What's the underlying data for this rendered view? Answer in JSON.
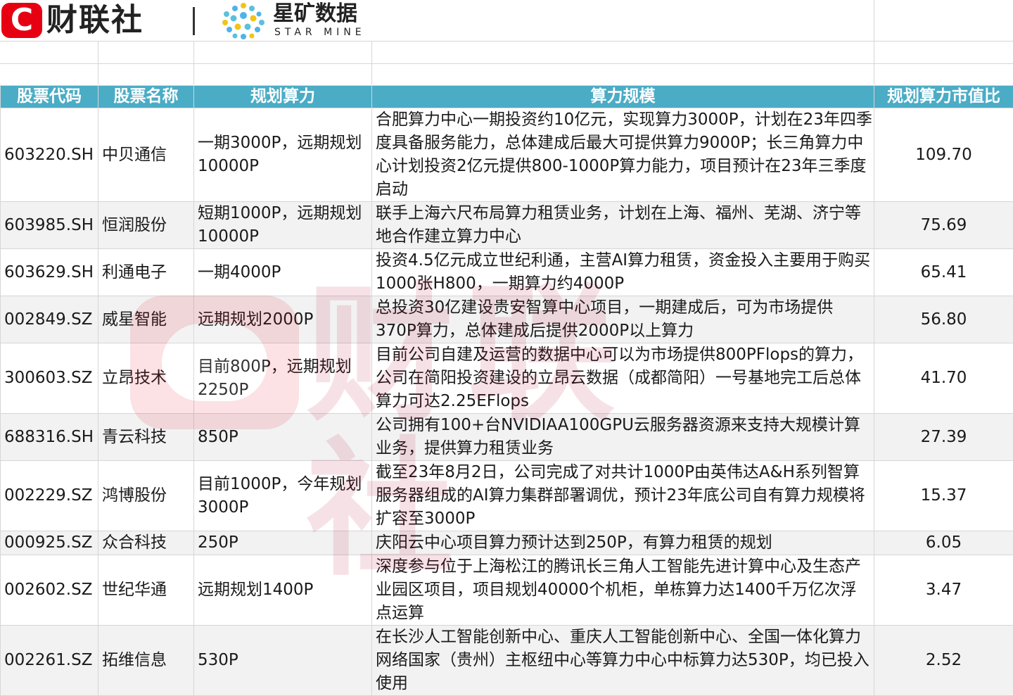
{
  "brand": {
    "logo_c": "C",
    "logo_name": "财联社",
    "partner_cn": "星矿数据",
    "partner_en": "STAR MINE"
  },
  "watermark_text": "财联社",
  "table": {
    "headers": [
      "股票代码",
      "股票名称",
      "规划算力",
      "算力规模",
      "规划算力市值比"
    ],
    "rows": [
      {
        "code": "603220.SH",
        "name": "中贝通信",
        "plan": "一期3000P，远期规划10000P",
        "scale": "合肥算力中心一期投资约10亿元，实现算力3000P，计划在23年四季度具备服务能力，总体建成后最大可提供算力9000P；长三角算力中心计划投资2亿元提供800-1000P算力能力，项目预计在23年三季度启动",
        "ratio": "109.70"
      },
      {
        "code": "603985.SH",
        "name": "恒润股份",
        "plan": "短期1000P，远期规划10000P",
        "scale": "联手上海六尺布局算力租赁业务，计划在上海、福州、芜湖、济宁等地合作建立算力中心",
        "ratio": "75.69"
      },
      {
        "code": "603629.SH",
        "name": "利通电子",
        "plan": "一期4000P",
        "scale": "投资4.5亿元成立世纪利通，主营AI算力租赁，资金投入主要用于购买1000张H800，一期算力约4000P",
        "ratio": "65.41"
      },
      {
        "code": "002849.SZ",
        "name": "威星智能",
        "plan": "远期规划2000P",
        "scale": "总投资30亿建设贵安智算中心项目，一期建成后，可为市场提供370P算力，总体建成后提供2000P以上算力",
        "ratio": "56.80"
      },
      {
        "code": "300603.SZ",
        "name": "立昂技术",
        "plan": "目前800P，远期规划2250P",
        "scale": "目前公司自建及运营的数据中心可以为市场提供800PFlops的算力，公司在简阳投资建设的立昂云数据（成都简阳）一号基地完工后总体算力可达2.25EFlops",
        "ratio": "41.70"
      },
      {
        "code": "688316.SH",
        "name": "青云科技",
        "plan": "850P",
        "scale": "公司拥有100+台NVIDIAA100GPU云服务器资源来支持大规模计算业务，提供算力租赁业务",
        "ratio": "27.39"
      },
      {
        "code": "002229.SZ",
        "name": "鸿博股份",
        "plan": "目前1000P，今年规划3000P",
        "scale": "截至23年8月2日，公司完成了对共计1000P由英伟达A&H系列智算服务器组成的AI算力集群部署调优，预计23年底公司自有算力规模将扩容至3000P",
        "ratio": "15.37"
      },
      {
        "code": "000925.SZ",
        "name": "众合科技",
        "plan": "250P",
        "scale": "庆阳云中心项目算力预计达到250P，有算力租赁的规划",
        "ratio": "6.05"
      },
      {
        "code": "002602.SZ",
        "name": "世纪华通",
        "plan": "远期规划1400P",
        "scale": "深度参与位于上海松江的腾讯长三角人工智能先进计算中心及生态产业园区项目，项目规划40000个机柜，单栋算力达1400千万亿次浮点运算",
        "ratio": "3.47"
      },
      {
        "code": "002261.SZ",
        "name": "拓维信息",
        "plan": "530P",
        "scale": "在长沙人工智能创新中心、重庆人工智能创新中心、全国一体化算力网络国家（贵州）主枢纽中心等算力中心中标算力达530P，均已投入使用",
        "ratio": "2.52"
      }
    ]
  }
}
